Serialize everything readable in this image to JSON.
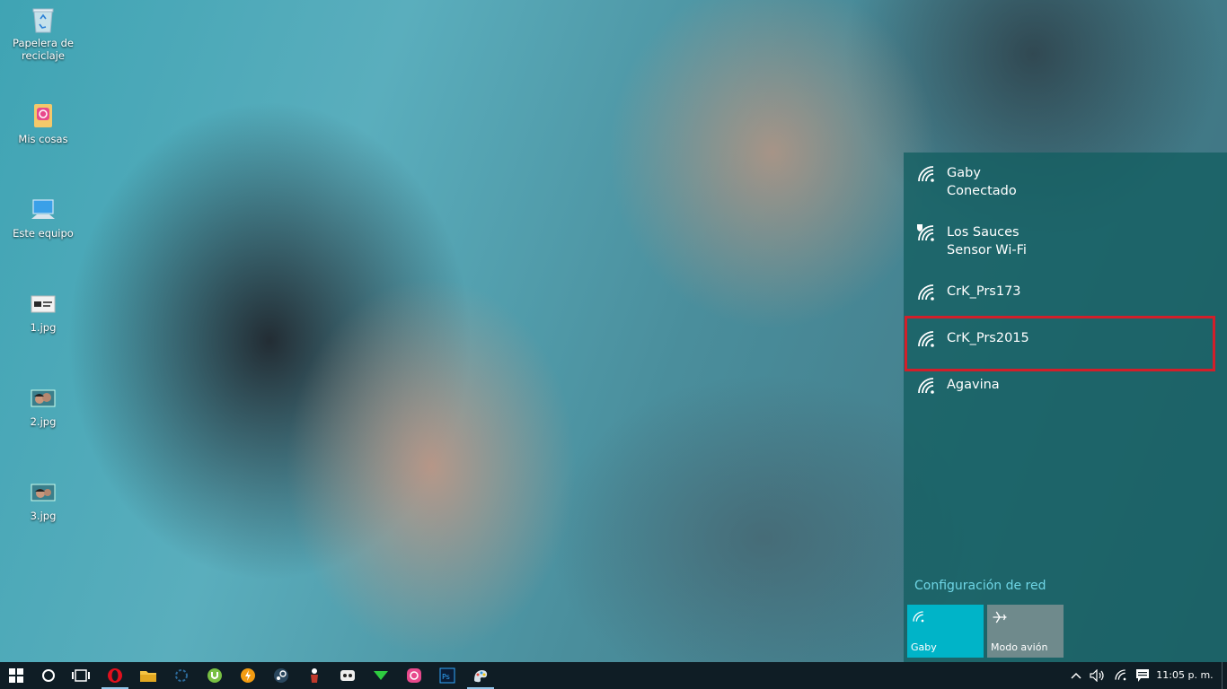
{
  "desktop": {
    "icons": [
      {
        "label": "Papelera de reciclaje",
        "icon": "recycle-bin-icon"
      },
      {
        "label": "Mis cosas",
        "icon": "folder-app-icon"
      },
      {
        "label": "Este equipo",
        "icon": "computer-icon"
      },
      {
        "label": "1.jpg",
        "icon": "image-file-icon"
      },
      {
        "label": "2.jpg",
        "icon": "image-file-icon"
      },
      {
        "label": "3.jpg",
        "icon": "image-file-icon"
      }
    ]
  },
  "network_flyout": {
    "networks": [
      {
        "name": "Gaby",
        "status": "Conectado",
        "icon": "wifi-icon"
      },
      {
        "name": "Los Sauces",
        "status": "Sensor Wi-Fi",
        "icon": "wifi-secured-icon"
      },
      {
        "name": "CrK_Prs173",
        "status": "",
        "icon": "wifi-icon"
      },
      {
        "name": "CrK_Prs2015",
        "status": "",
        "icon": "wifi-icon",
        "highlighted": true
      },
      {
        "name": "Agavina",
        "status": "",
        "icon": "wifi-icon"
      }
    ],
    "settings_link": "Configuración de red",
    "tiles": [
      {
        "label": "Gaby",
        "icon": "wifi-icon",
        "active": true,
        "color": "#00b4c8"
      },
      {
        "label": "Modo avión",
        "icon": "airplane-icon",
        "active": false,
        "color": "#6f8a8c"
      }
    ],
    "highlight_color": "#d21f2a"
  },
  "taskbar": {
    "apps": [
      {
        "icon": "opera-icon",
        "active": true
      },
      {
        "icon": "file-explorer-icon",
        "active": false
      },
      {
        "icon": "loader-icon",
        "active": false
      },
      {
        "icon": "utorrent-icon",
        "active": false
      },
      {
        "icon": "lightning-app-icon",
        "active": false
      },
      {
        "icon": "steam-icon",
        "active": false
      },
      {
        "icon": "game-figure-icon",
        "active": false
      },
      {
        "icon": "controller-icon",
        "active": false
      },
      {
        "icon": "arrow-app-icon",
        "active": false
      },
      {
        "icon": "camera-app-icon",
        "active": false
      },
      {
        "icon": "photoshop-icon",
        "active": false
      },
      {
        "icon": "paint-app-icon",
        "active": true
      }
    ],
    "clock": "11:05 p. m."
  }
}
